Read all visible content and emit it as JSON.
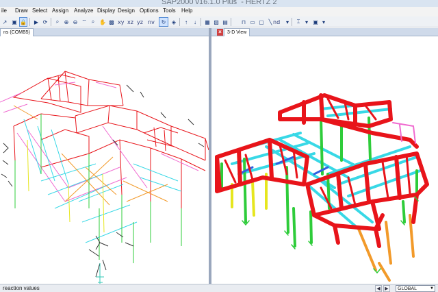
{
  "title_bar": {
    "title": "SAP2000 v16.1.0 Plus  - HERTZ 2"
  },
  "menu": [
    "ile",
    "Draw",
    "Select",
    "Assign",
    "Analyze",
    "Display",
    "Design",
    "Options",
    "Tools",
    "Help"
  ],
  "toolbar": {
    "view_labels": [
      "xy",
      "xz",
      "yz",
      "nv"
    ],
    "toggle_label": "nd"
  },
  "left_window": {
    "tab_label": "ns (COMB5)"
  },
  "right_window": {
    "tab_label": "3-D View",
    "close_glyph": "×"
  },
  "status_bar": {
    "message": "reaction values",
    "coordinate_system": "GLOBAL"
  },
  "colors": {
    "frame_red": "#e8141a",
    "frame_cyan": "#38d8e6",
    "frame_green": "#2ecc3a",
    "frame_yellow": "#e6e61e",
    "frame_orange": "#f29a2a",
    "frame_blue": "#2f5fe0",
    "frame_pink": "#f06ad0",
    "window_tab_bg": "#cfdaea"
  }
}
